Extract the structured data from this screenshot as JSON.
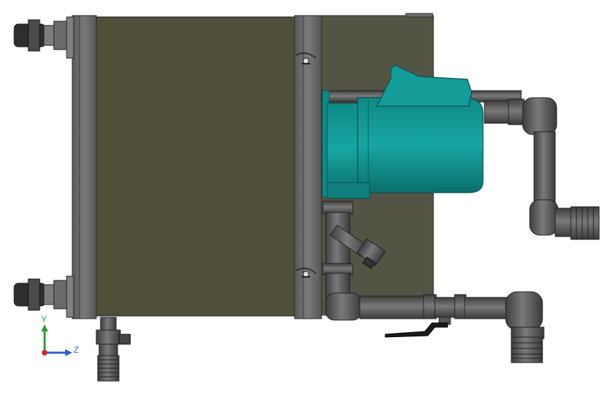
{
  "view": {
    "background": "#ffffff"
  },
  "colors": {
    "tank": "#4f4f3a",
    "frame": "#626262",
    "pipe": "#5b5b5b",
    "pump": "#12908e",
    "pump_dark": "#0b6f6c",
    "caster": "#3a3a3a",
    "handle": "#1a1a1a"
  },
  "triad": {
    "y_label": "Y",
    "z_label": "Z",
    "y_color": "#2e9e3a",
    "z_color": "#2a5fd6",
    "x_color": "#d02828"
  }
}
